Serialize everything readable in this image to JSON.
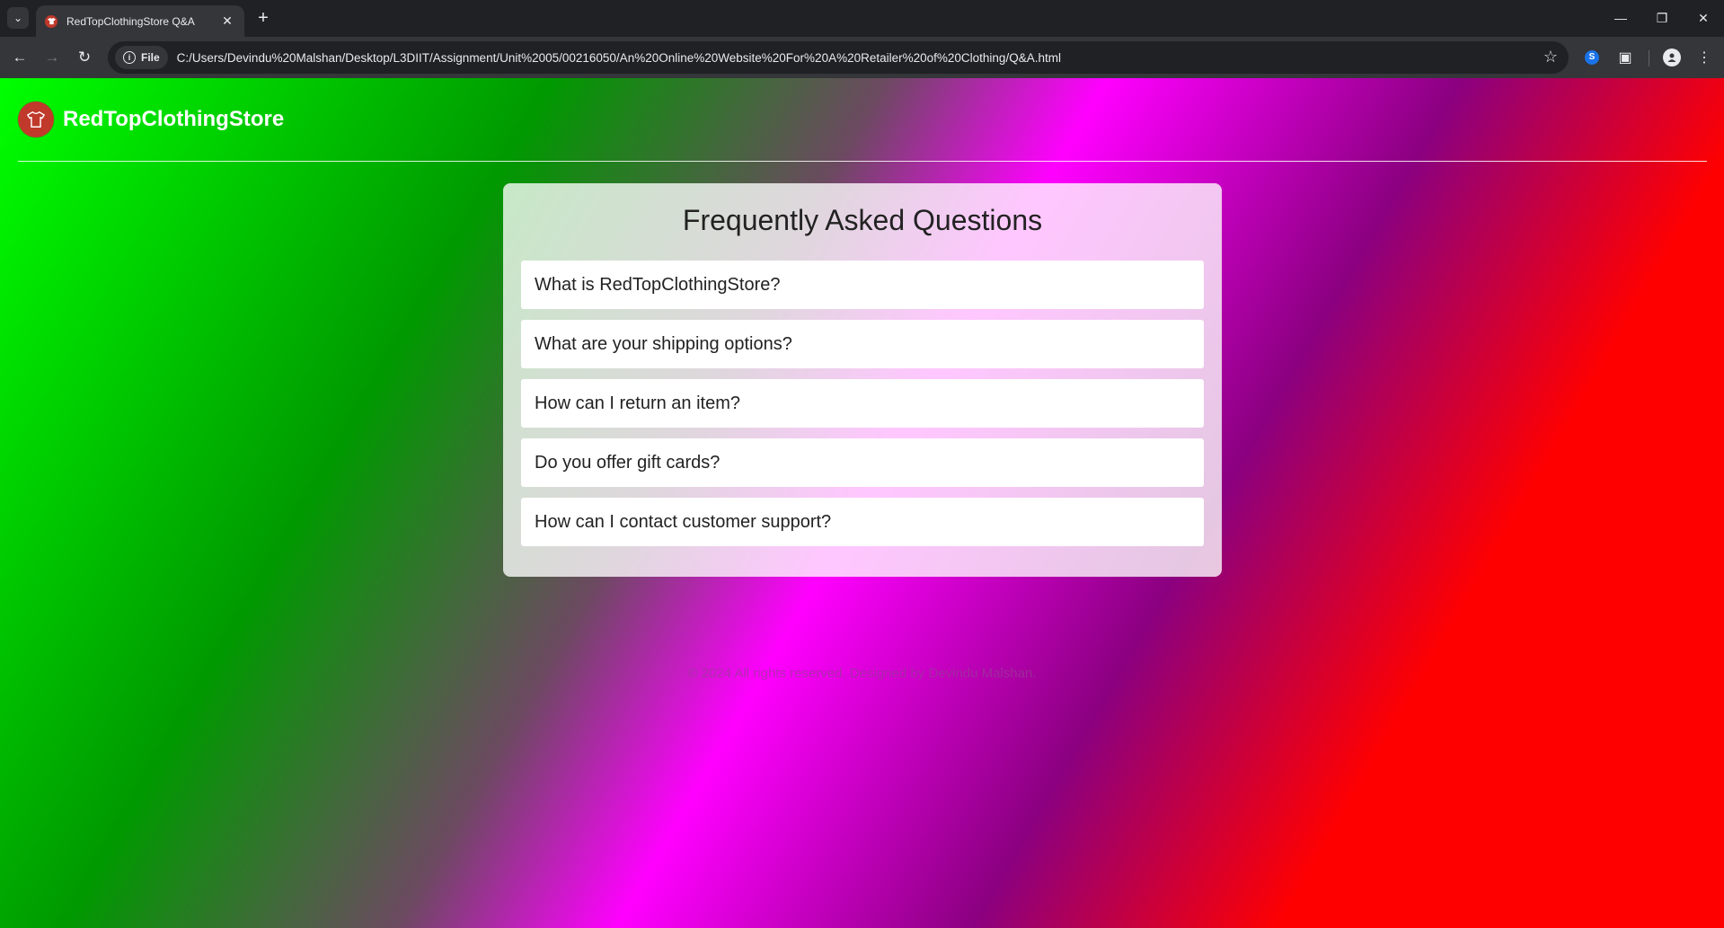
{
  "browser": {
    "tab_title": "RedTopClothingStore Q&A",
    "url_chip": "File",
    "url": "C:/Users/Devindu%20Malshan/Desktop/L3DIIT/Assignment/Unit%2005/00216050/An%20Online%20Website%20For%20A%20Retailer%20of%20Clothing/Q&A.html"
  },
  "site": {
    "name": "RedTopClothingStore"
  },
  "faq": {
    "title": "Frequently Asked Questions",
    "items": [
      "What is RedTopClothingStore?",
      "What are your shipping options?",
      "How can I return an item?",
      "Do you offer gift cards?",
      "How can I contact customer support?"
    ]
  },
  "footer": {
    "text": "© 2024 All rights reserved. Designed by Devindu Malshan."
  }
}
